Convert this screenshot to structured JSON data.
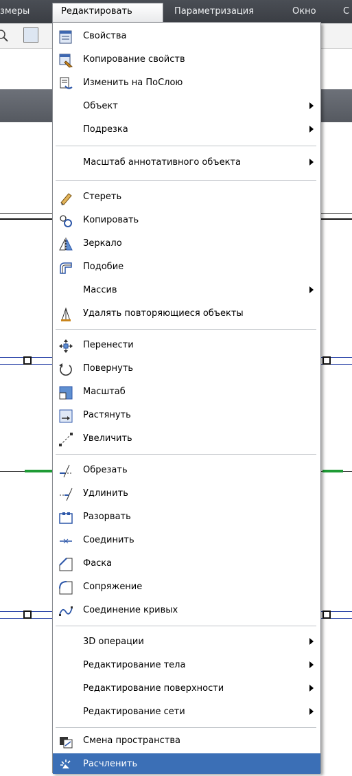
{
  "menubar": {
    "items": [
      "змеры",
      "Редактировать",
      "Параметризация",
      "Окно",
      "С"
    ]
  },
  "menu": {
    "items": [
      {
        "label": "Свойства",
        "icon": "properties-icon"
      },
      {
        "label": "Копирование свойств",
        "icon": "match-properties-icon"
      },
      {
        "label": "Изменить на ПоСлою",
        "icon": "change-to-bylayer-icon"
      },
      {
        "label": "Объект",
        "submenu": true
      },
      {
        "label": "Подрезка",
        "submenu": true
      },
      {
        "label": "Масштаб аннотативного объекта",
        "submenu": true
      },
      {
        "label": "Стереть",
        "icon": "eraser-icon"
      },
      {
        "label": "Копировать",
        "icon": "copy-icon"
      },
      {
        "label": "Зеркало",
        "icon": "mirror-icon"
      },
      {
        "label": "Подобие",
        "icon": "offset-icon"
      },
      {
        "label": "Массив",
        "submenu": true
      },
      {
        "label": "Удалять повторяющиеся объекты",
        "icon": "overkill-icon"
      },
      {
        "label": "Перенести",
        "icon": "move-icon"
      },
      {
        "label": "Повернуть",
        "icon": "rotate-icon"
      },
      {
        "label": "Масштаб",
        "icon": "scale-icon"
      },
      {
        "label": "Растянуть",
        "icon": "stretch-icon"
      },
      {
        "label": "Увеличить",
        "icon": "lengthen-icon"
      },
      {
        "label": "Обрезать",
        "icon": "trim-icon"
      },
      {
        "label": "Удлинить",
        "icon": "extend-icon"
      },
      {
        "label": "Разорвать",
        "icon": "break-icon"
      },
      {
        "label": "Соединить",
        "icon": "join-icon"
      },
      {
        "label": "Фаска",
        "icon": "chamfer-icon"
      },
      {
        "label": "Сопряжение",
        "icon": "fillet-icon"
      },
      {
        "label": "Соединение кривых",
        "icon": "blend-curves-icon"
      },
      {
        "label": "3D операции",
        "submenu": true
      },
      {
        "label": "Редактирование тела",
        "submenu": true
      },
      {
        "label": "Редактирование поверхности",
        "submenu": true
      },
      {
        "label": "Редактирование сети",
        "submenu": true
      },
      {
        "label": "Смена пространства",
        "icon": "change-space-icon"
      },
      {
        "label": "Расчленить",
        "icon": "explode-icon",
        "highlighted": true
      }
    ]
  },
  "colors": {
    "menubar_bg": "#3a3d43",
    "highlight": "#3b6fb6",
    "ribbon": "#5f636a"
  }
}
